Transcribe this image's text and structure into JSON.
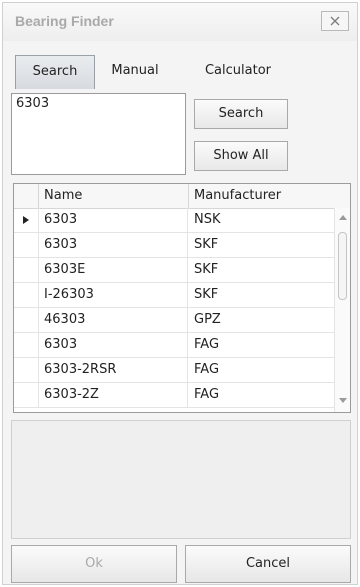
{
  "window": {
    "title": "Bearing Finder"
  },
  "tabs": [
    {
      "label": "Search",
      "active": true
    },
    {
      "label": "Manual",
      "active": false
    },
    {
      "label": "Calculator",
      "active": false
    }
  ],
  "search": {
    "query_value": "6303",
    "search_button": "Search",
    "show_all_button": "Show All"
  },
  "grid": {
    "columns": [
      "Name",
      "Manufacturer"
    ],
    "rows": [
      {
        "name": "6303",
        "manufacturer": "NSK",
        "current": true
      },
      {
        "name": "6303",
        "manufacturer": "SKF"
      },
      {
        "name": "6303E",
        "manufacturer": "SKF"
      },
      {
        "name": "I-26303",
        "manufacturer": "SKF"
      },
      {
        "name": "46303",
        "manufacturer": "GPZ"
      },
      {
        "name": "6303",
        "manufacturer": "FAG"
      },
      {
        "name": "6303-2RSR",
        "manufacturer": "FAG"
      },
      {
        "name": "6303-2Z",
        "manufacturer": "FAG"
      }
    ]
  },
  "footer": {
    "ok_label": "Ok",
    "cancel_label": "Cancel"
  },
  "colors": {
    "disabled_text": "#a9a9a9",
    "border": "#9b9b9b"
  },
  "icons": {
    "close": "close-icon",
    "row_indicator": "row-indicator-icon",
    "scroll_up": "chevron-up-icon",
    "scroll_down": "chevron-down-icon"
  }
}
